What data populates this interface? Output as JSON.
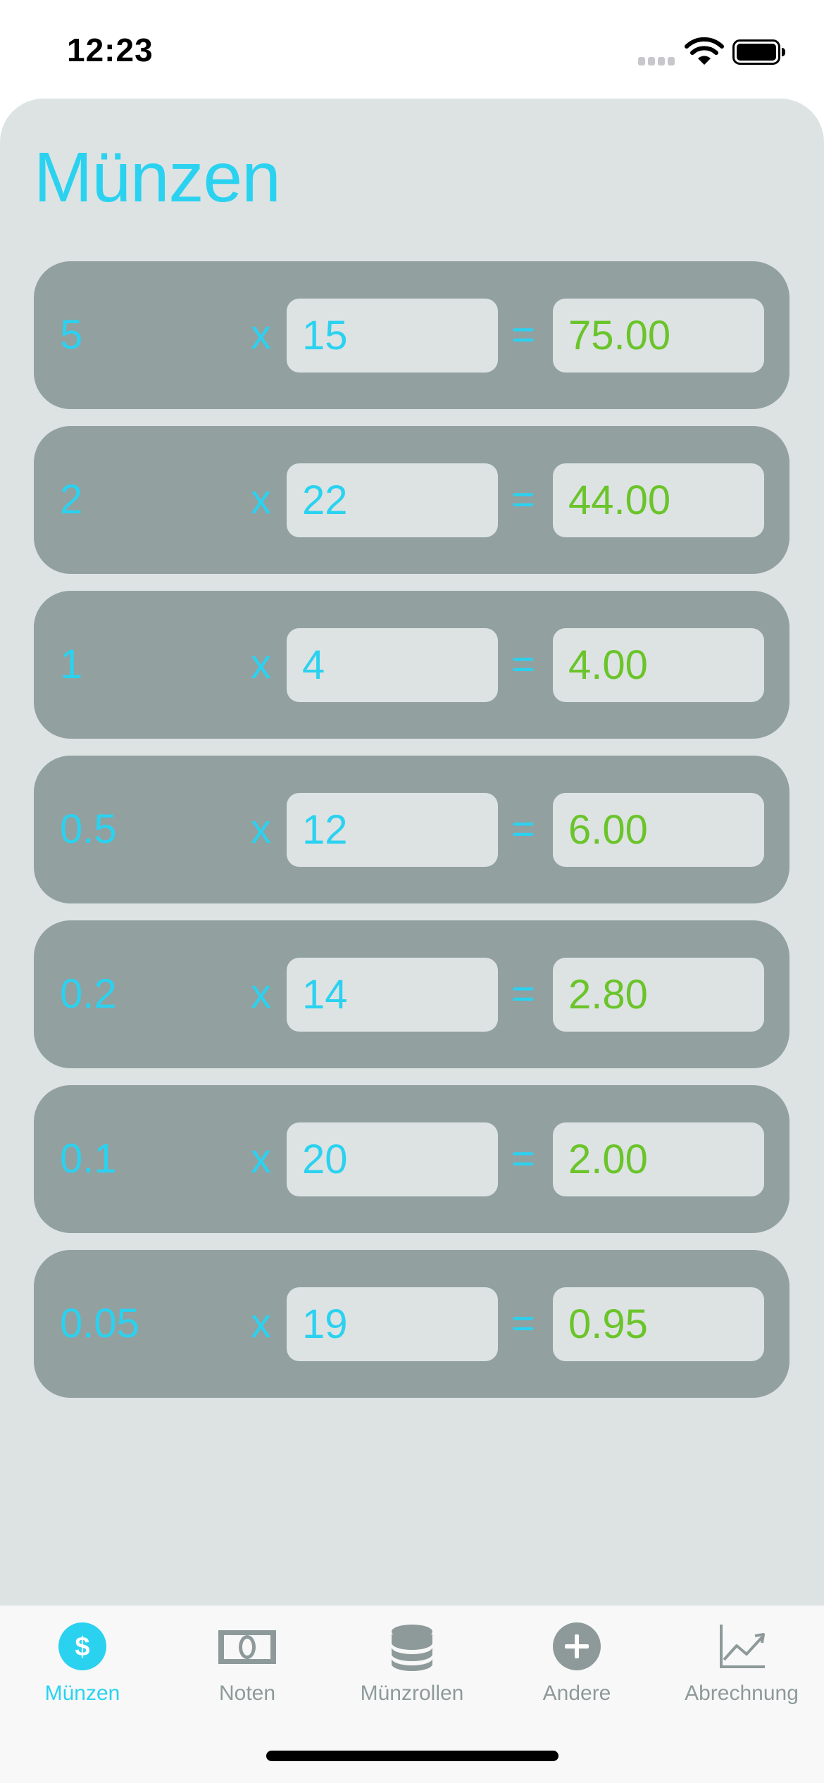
{
  "status_bar": {
    "time": "12:23"
  },
  "page": {
    "title": "Münzen"
  },
  "rows": [
    {
      "denomination": "5",
      "times": "x",
      "count": "15",
      "equals": "=",
      "total": "75.00"
    },
    {
      "denomination": "2",
      "times": "x",
      "count": "22",
      "equals": "=",
      "total": "44.00"
    },
    {
      "denomination": "1",
      "times": "x",
      "count": "4",
      "equals": "=",
      "total": "4.00"
    },
    {
      "denomination": "0.5",
      "times": "x",
      "count": "12",
      "equals": "=",
      "total": "6.00"
    },
    {
      "denomination": "0.2",
      "times": "x",
      "count": "14",
      "equals": "=",
      "total": "2.80"
    },
    {
      "denomination": "0.1",
      "times": "x",
      "count": "20",
      "equals": "=",
      "total": "2.00"
    },
    {
      "denomination": "0.05",
      "times": "x",
      "count": "19",
      "equals": "=",
      "total": "0.95"
    }
  ],
  "tab_bar": {
    "tabs": [
      {
        "label": "Münzen",
        "icon": "dollar-circle-icon",
        "active": true
      },
      {
        "label": "Noten",
        "icon": "banknote-icon",
        "active": false
      },
      {
        "label": "Münzrollen",
        "icon": "coin-stack-icon",
        "active": false
      },
      {
        "label": "Andere",
        "icon": "plus-circle-icon",
        "active": false
      },
      {
        "label": "Abrechnung",
        "icon": "chart-line-icon",
        "active": false
      }
    ]
  },
  "colors": {
    "accent": "#2bd2f0",
    "total_text": "#6ac42a",
    "card": "#92a0a0",
    "background": "#dde3e3",
    "inactive_tab": "#8e9a9a"
  }
}
